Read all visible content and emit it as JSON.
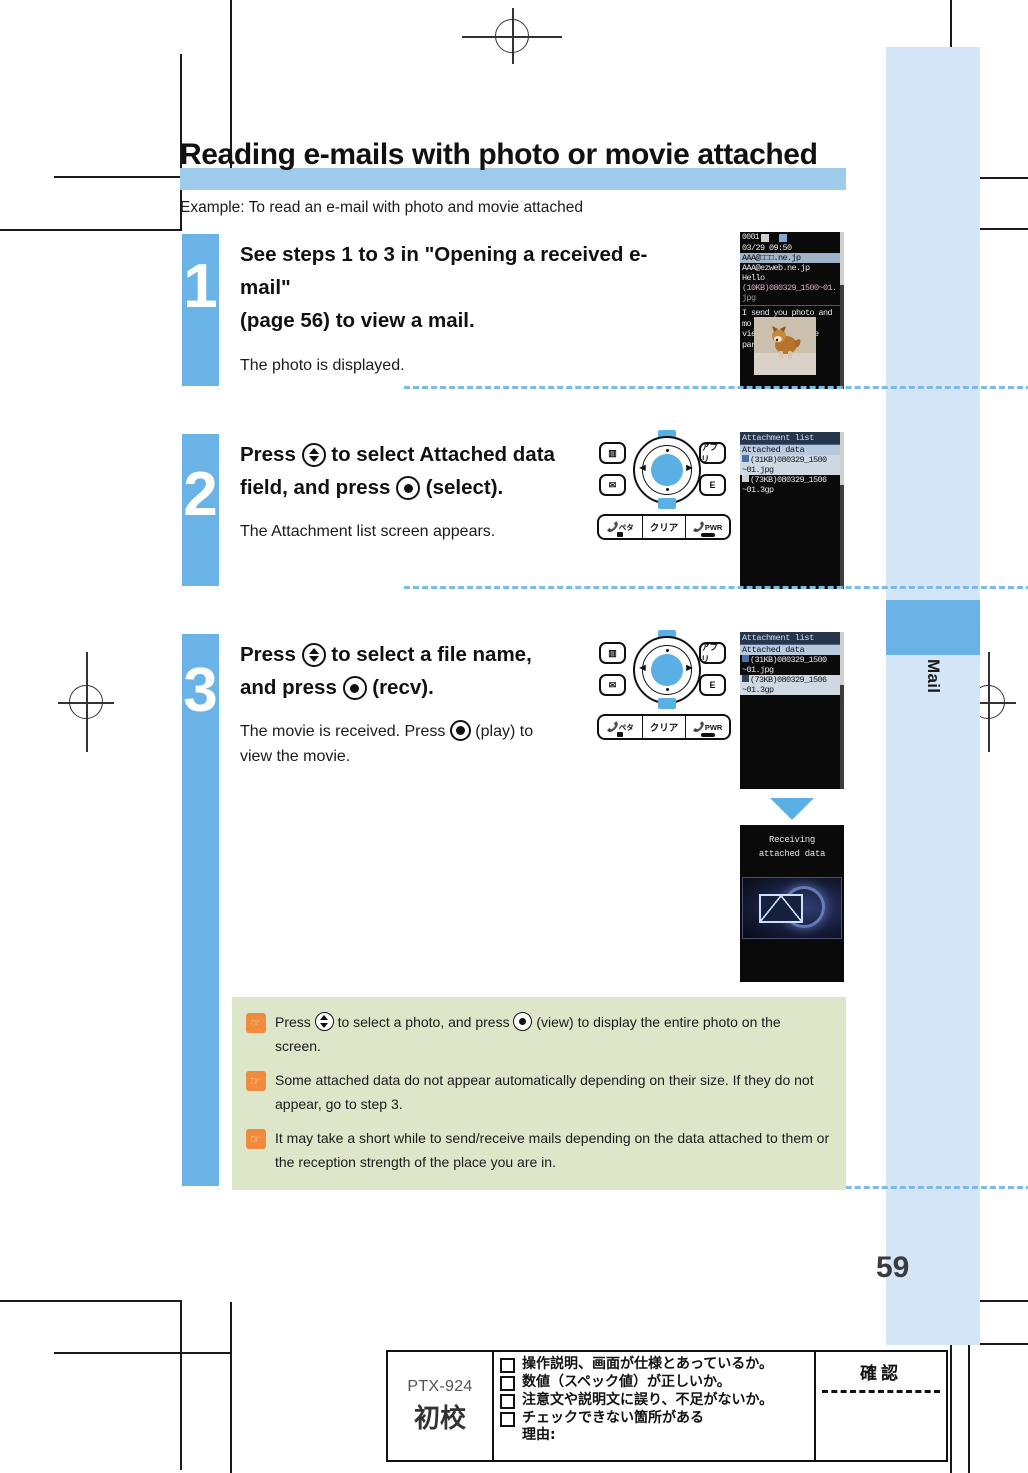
{
  "page": {
    "heading": "Reading e-mails with photo or movie attached",
    "example": "Example: To read an e-mail with photo and movie attached",
    "page_number": "59",
    "tab_label": "Mail",
    "accent_blue": "#69b3e7",
    "tab_blue": "#d3e5f6",
    "heading_rule": "#9ecbec",
    "note_bg": "#dde6c8",
    "note_icon_color": "#f08a3c"
  },
  "steps": [
    {
      "number": "1",
      "main_a": "See steps 1 to 3 in \"Opening a received e-mail\"",
      "main_b": "(page 56) to view a mail.",
      "sub": "The photo is displayed."
    },
    {
      "number": "2",
      "main_a": "Press ",
      "main_b": " to select Attached data",
      "main_c": "field, and press ",
      "main_d": " (select).",
      "sub": "The Attachment list screen appears."
    },
    {
      "number": "3",
      "main_a": "Press ",
      "main_b": " to select a file name,",
      "main_c": "and press ",
      "main_d": " (recv).",
      "sub_a": "The movie is received. Press ",
      "sub_b": " (play) to",
      "sub_c": "view the movie."
    }
  ],
  "keypad": {
    "book_key": "book-icon",
    "mail_key": "mail-icon",
    "apli_key": "アプリ",
    "ez_key": "E",
    "call_key": "ペタ",
    "clear_key": "クリア",
    "power_key": "PWR",
    "left_arrow": "◄",
    "right_arrow": "►"
  },
  "screens": {
    "mail_view": {
      "status_left": "0001",
      "date_time": "03/29 09:50",
      "from_line": "AAA@□□□.ne.jp",
      "to_line": "AAA@ezweb.ne.jp",
      "subject": "Hello",
      "attach_line_a": "(10KB)080329_1500~01.",
      "attach_line_b": "jpg",
      "body_a": "I send you photo and mo",
      "body_b": "vie I took at the park."
    },
    "attachment_list": {
      "title": "Attachment list",
      "section": "Attached data",
      "item1_a": "(31KB)080329_1500",
      "item1_b": "~01.jpg",
      "item2_a": "(73KB)080329_1506",
      "item2_b": "~01.3gp",
      "selected_step2": "item1",
      "selected_step3": "item2"
    },
    "receiving": {
      "line1": "Receiving",
      "line2": "attached data"
    }
  },
  "notes": [
    {
      "a": "Press ",
      "b": " to select a photo, and press ",
      "c": " (view) to display the entire photo on the screen."
    },
    {
      "text": "Some attached data do not appear automatically depending on their size. If they do not appear, go to step 3."
    },
    {
      "text": "It may take a short while to send/receive mails depending on the data attached to them or the reception strength of the place you are in."
    }
  ],
  "proof_form": {
    "code": "PTX-924",
    "stage": "初校",
    "confirm_label": "確認",
    "checks": [
      "操作説明、画面が仕様とあっているか。",
      "数値（スペック値）が正しいか。",
      "注意文や説明文に誤り、不足がないか。",
      "チェックできない箇所がある\n理由:"
    ]
  }
}
